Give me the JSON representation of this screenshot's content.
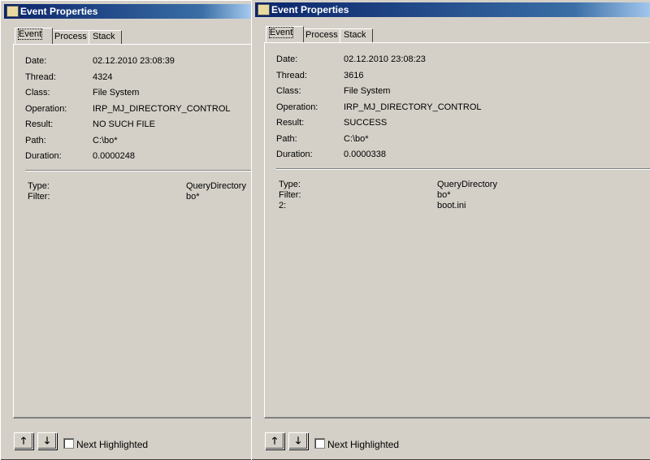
{
  "windows": [
    {
      "title": "Event Properties",
      "tabs": [
        "Event",
        "Process",
        "Stack"
      ],
      "fields": [
        {
          "label": "Date:",
          "value": "02.12.2010 23:08:39"
        },
        {
          "label": "Thread:",
          "value": "4324"
        },
        {
          "label": "Class:",
          "value": "File System"
        },
        {
          "label": "Operation:",
          "value": "IRP_MJ_DIRECTORY_CONTROL"
        },
        {
          "label": "Result:",
          "value": "NO SUCH FILE"
        },
        {
          "label": "Path:",
          "value": "C:\\bo*"
        },
        {
          "label": "Duration:",
          "value": "0.0000248"
        }
      ],
      "details": [
        {
          "label": "Type:",
          "value": "QueryDirectory"
        },
        {
          "label": "Filter:",
          "value": "bo*"
        }
      ],
      "up": "🡑",
      "down": "🡓",
      "next_highlighted": "Next Highlighted"
    },
    {
      "title": "Event Properties",
      "tabs": [
        "Event",
        "Process",
        "Stack"
      ],
      "fields": [
        {
          "label": "Date:",
          "value": "02.12.2010 23:08:23"
        },
        {
          "label": "Thread:",
          "value": "3616"
        },
        {
          "label": "Class:",
          "value": "File System"
        },
        {
          "label": "Operation:",
          "value": "IRP_MJ_DIRECTORY_CONTROL"
        },
        {
          "label": "Result:",
          "value": "SUCCESS"
        },
        {
          "label": "Path:",
          "value": "C:\\bo*"
        },
        {
          "label": "Duration:",
          "value": "0.0000338"
        }
      ],
      "details": [
        {
          "label": "Type:",
          "value": "QueryDirectory"
        },
        {
          "label": "Filter:",
          "value": "bo*"
        },
        {
          "label": "2:",
          "value": "boot.ini"
        }
      ],
      "up": "🡑",
      "down": "🡓",
      "next_highlighted": "Next Highlighted"
    }
  ]
}
